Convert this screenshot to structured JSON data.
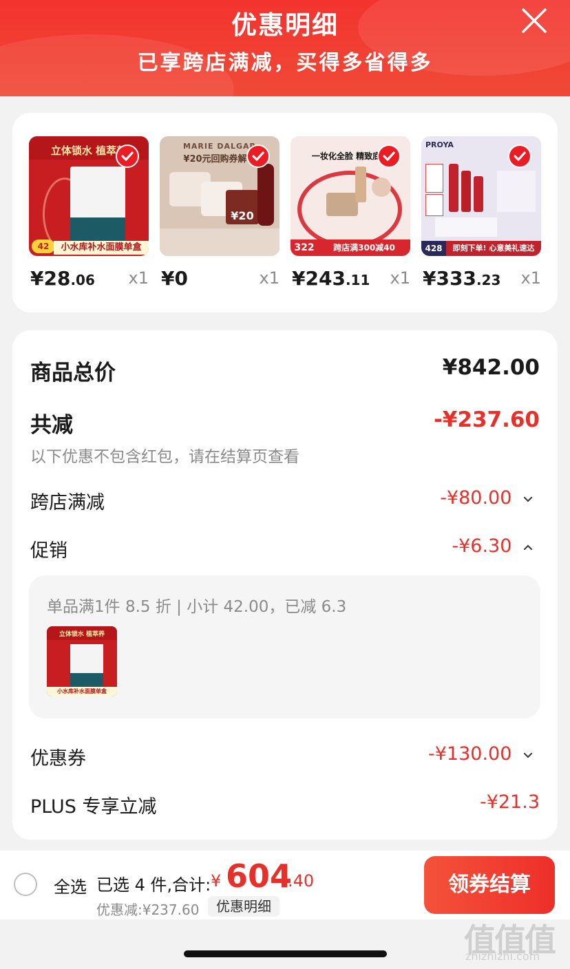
{
  "header": {
    "title": "优惠明细",
    "subtitle": "已享跨店满减，买得多省得多"
  },
  "products": [
    {
      "price_int": "¥28",
      "price_dec": ".06",
      "qty": "x1",
      "banner": "小水库补水面膜单盒",
      "tag": "立体锁水 植萃养"
    },
    {
      "price_int": "¥0",
      "price_dec": "",
      "qty": "x1",
      "banner": "¥20元回购券解锁",
      "tag": "MARIE DALGAR",
      "badge": "¥20"
    },
    {
      "price_int": "¥243",
      "price_dec": ".11",
      "qty": "x1",
      "banner": "跨店满300减40",
      "tag": "一妆化全脸 精致底妆",
      "badge": "322"
    },
    {
      "price_int": "¥333",
      "price_dec": ".23",
      "qty": "x1",
      "banner": "即刻下单! 心意美礼速达",
      "tag": "PROYA",
      "badge": "428"
    }
  ],
  "summary": {
    "total_label": "商品总价",
    "total_value": "¥842.00",
    "reduce_label": "共减",
    "reduce_value": "-¥237.60",
    "note": "以下优惠不包含红包，请在结算页查看",
    "cross_label": "跨店满减",
    "cross_value": "-¥80.00",
    "promo_label": "促销",
    "promo_value": "-¥6.30",
    "promo_detail": "单品满1件 8.5 折 | 小计 42.00，已减 6.3",
    "coupon_label": "优惠券",
    "coupon_value": "-¥130.00",
    "plus_label": "PLUS 专享立减",
    "plus_value": "-¥21.3"
  },
  "footer": {
    "select_all": "全选",
    "selected_info": "已选 4 件,合计:",
    "total_currency": "¥",
    "total_int": "604",
    "total_dec": ".40",
    "discount": "优惠减:¥237.60",
    "detail_link": "优惠明细",
    "checkout": "领券结算"
  },
  "watermark": {
    "brand": "值值值",
    "url": "zhizhizhi.com"
  },
  "colors": {
    "accent": "#e8302a",
    "header": "#f3332e"
  }
}
